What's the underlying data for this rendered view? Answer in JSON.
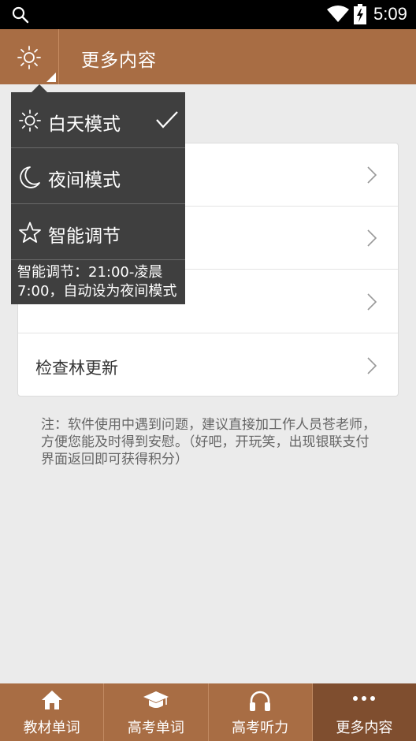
{
  "status": {
    "time": "5:09"
  },
  "app_bar": {
    "title": "更多内容"
  },
  "list": {
    "rows": [
      {
        "label": ""
      },
      {
        "label": ""
      },
      {
        "label": ""
      },
      {
        "label": "检查林更新"
      }
    ]
  },
  "note": "注：软件使用中遇到问题，建议直接加工作人员苍老师，方便您能及时得到安慰。（好吧，开玩笑，出现银联支付界面返回即可获得积分）",
  "mode_menu": {
    "items": [
      {
        "label": "白天模式",
        "icon": "sun-icon",
        "selected": true
      },
      {
        "label": "夜间模式",
        "icon": "moon-icon",
        "selected": false
      },
      {
        "label": "智能调节",
        "icon": "star-icon",
        "selected": false
      }
    ],
    "description": "智能调节：21:00-凌晨7:00，自动设为夜间模式"
  },
  "bottom_nav": {
    "tabs": [
      {
        "label": "教材单词",
        "icon": "home-icon",
        "active": false
      },
      {
        "label": "高考单词",
        "icon": "graduation-cap-icon",
        "active": false
      },
      {
        "label": "高考听力",
        "icon": "headphones-icon",
        "active": false
      },
      {
        "label": "更多内容",
        "icon": "more-dots-icon",
        "active": true
      }
    ]
  },
  "colors": {
    "brand": "#a86d44",
    "brand_active": "#7f4e2f",
    "menu_bg": "#3f3f3f",
    "page_bg": "#ebebeb"
  }
}
